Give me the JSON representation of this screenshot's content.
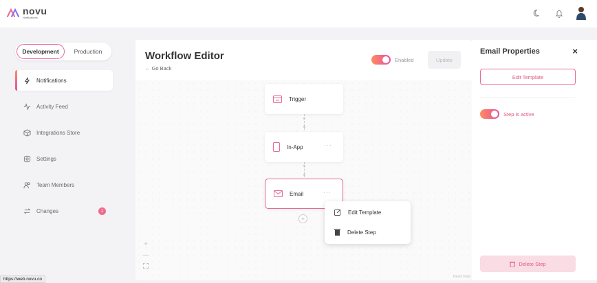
{
  "brand": {
    "name": "novu",
    "tagline": "Notifications",
    "accent": "#e8699a"
  },
  "topbar": {
    "icons": [
      "moon-icon",
      "bell-icon",
      "avatar"
    ]
  },
  "env": {
    "development": "Development",
    "production": "Production"
  },
  "sidebar": {
    "items": [
      {
        "label": "Notifications",
        "icon": "lightning-icon"
      },
      {
        "label": "Activity Feed",
        "icon": "activity-icon"
      },
      {
        "label": "Integrations Store",
        "icon": "box-icon"
      },
      {
        "label": "Settings",
        "icon": "gear-icon"
      },
      {
        "label": "Team Members",
        "icon": "users-icon"
      },
      {
        "label": "Changes",
        "icon": "swap-icon",
        "badge": "1"
      }
    ]
  },
  "editor": {
    "title": "Workflow Editor",
    "back": "← Go Back",
    "enabled_label": "Enabled",
    "update_label": "Update"
  },
  "nodes": [
    {
      "label": "Trigger",
      "icon": "trigger-icon"
    },
    {
      "label": "In-App",
      "icon": "mobile-icon"
    },
    {
      "label": "Email",
      "icon": "envelope-icon"
    }
  ],
  "context_menu": {
    "edit": "Edit Template",
    "delete": "Delete Step"
  },
  "canvas": {
    "zoom_in": "+",
    "zoom_out": "—",
    "attribution": "React Flow"
  },
  "properties": {
    "title": "Email Properties",
    "close": "×",
    "edit_template": "Edit Template",
    "step_active": "Step is active",
    "delete_step": "Delete Step"
  },
  "status_url": "https://web.novu.co"
}
